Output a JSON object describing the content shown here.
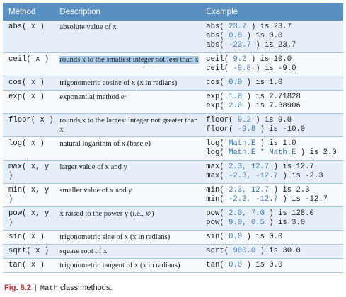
{
  "headers": {
    "method": "Method",
    "description": "Description",
    "example": "Example"
  },
  "rows": [
    {
      "method": "abs( x )",
      "description": "absolute value of x",
      "examples": [
        [
          "abs( ",
          "23.7",
          " ) is 23.7"
        ],
        [
          "abs( ",
          "0.0",
          " ) is 0.0"
        ],
        [
          "abs( ",
          "-23.7",
          " ) is 23.7"
        ]
      ]
    },
    {
      "method": "ceil( x )",
      "description": "rounds x to the smallest integer not less than x",
      "highlight": true,
      "examples": [
        [
          "ceil( ",
          "9.2",
          " ) is 10.0"
        ],
        [
          "ceil( ",
          "-9.8",
          " ) is -9.0"
        ]
      ]
    },
    {
      "method": "cos( x )",
      "description": "trigonometric cosine of x (x in radians)",
      "examples": [
        [
          "cos( ",
          "0.0",
          " ) is 1.0"
        ]
      ]
    },
    {
      "method": "exp( x )",
      "description": "exponential method eˣ",
      "examples": [
        [
          "exp( ",
          "1.0",
          " ) is 2.71828"
        ],
        [
          "exp( ",
          "2.0",
          " ) is 7.38906"
        ]
      ]
    },
    {
      "method": "floor( x )",
      "description": "rounds x to the largest integer not greater than x",
      "examples": [
        [
          "floor( ",
          "9.2",
          " ) is 9.0"
        ],
        [
          "floor( ",
          "-9.8",
          " ) is -10.0"
        ]
      ]
    },
    {
      "method": "log( x )",
      "description": "natural logarithm of x (base e)",
      "examples": [
        [
          "log( ",
          "Math.E",
          " ) is 1.0"
        ],
        [
          "log( ",
          "Math.E * Math.E",
          " ) is 2.0"
        ]
      ]
    },
    {
      "method": "max( x, y )",
      "description": "larger value of x and y",
      "examples": [
        [
          "max( ",
          "2.3, 12.7",
          " ) is 12.7"
        ],
        [
          "max( ",
          "-2.3, -12.7",
          " ) is -2.3"
        ]
      ]
    },
    {
      "method": "min( x, y )",
      "description": "smaller value of x and y",
      "examples": [
        [
          "min( ",
          "2.3, 12.7",
          " ) is 2.3"
        ],
        [
          "min( ",
          "-2.3, -12.7",
          " ) is -12.7"
        ]
      ]
    },
    {
      "method": "pow( x, y )",
      "description": "x raised to the power y (i.e., xʸ)",
      "examples": [
        [
          "pow( ",
          "2.0, 7.0",
          " ) is 128.0"
        ],
        [
          "pow( ",
          "9.0, 0.5",
          " ) is 3.0"
        ]
      ]
    },
    {
      "method": "sin( x )",
      "description": "trigonometric sine of x (x in radians)",
      "examples": [
        [
          "sin( ",
          "0.0",
          " ) is 0.0"
        ]
      ]
    },
    {
      "method": "sqrt( x )",
      "description": "square root of x",
      "examples": [
        [
          "sqrt( ",
          "900.0",
          " ) is 30.0"
        ]
      ]
    },
    {
      "method": "tan( x )",
      "description": "trigonometric tangent of x (x in radians)",
      "examples": [
        [
          "tan( ",
          "0.0",
          " ) is 0.0"
        ]
      ]
    }
  ],
  "caption": {
    "figure": "Fig. 6.2",
    "class_name": "Math",
    "text": " class methods."
  }
}
